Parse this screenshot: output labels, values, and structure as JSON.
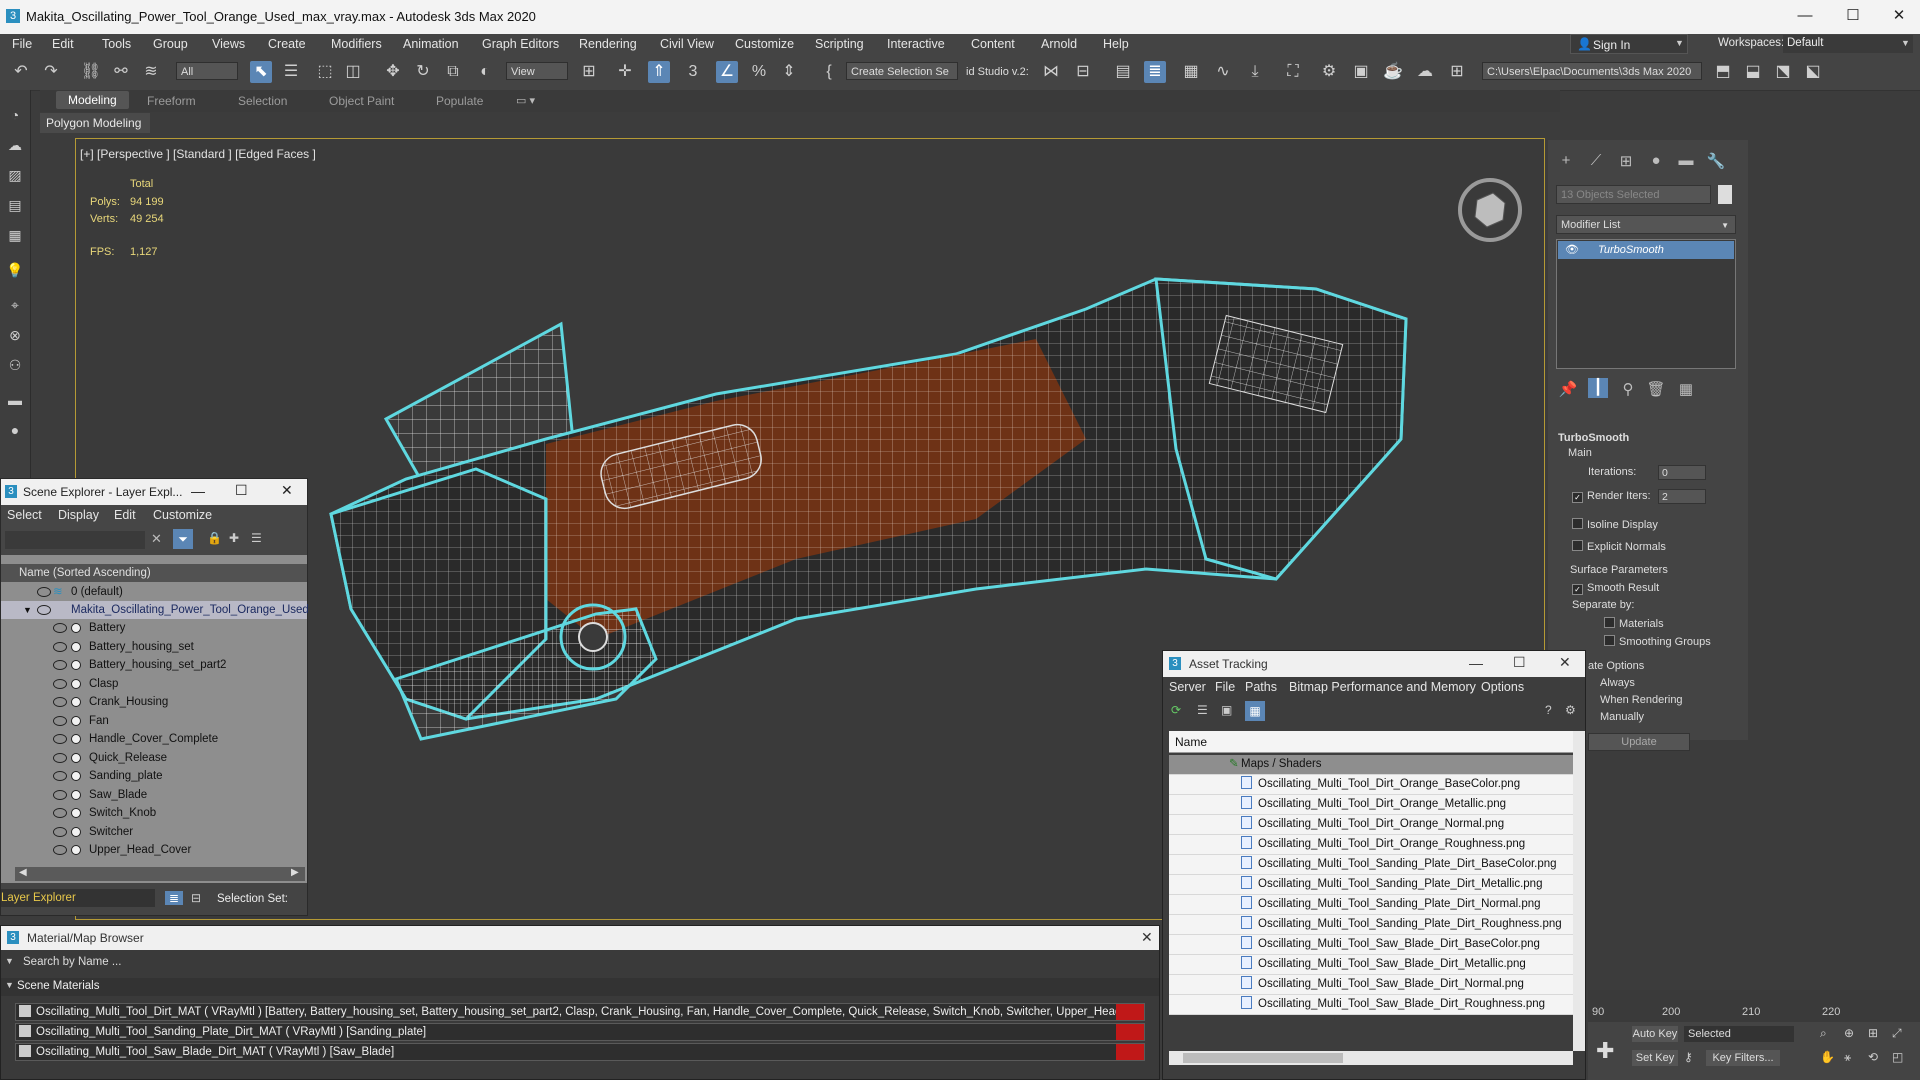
{
  "window": {
    "title": "Makita_Oscillating_Power_Tool_Orange_Used_max_vray.max - Autodesk 3ds Max 2020",
    "minimize": "—",
    "maximize": "☐",
    "close": "✕"
  },
  "menu": [
    "File",
    "Edit",
    "Tools",
    "Group",
    "Views",
    "Create",
    "Modifiers",
    "Animation",
    "Graph Editors",
    "Rendering",
    "Civil View",
    "Customize",
    "Scripting",
    "Interactive",
    "Content",
    "Arnold",
    "Help"
  ],
  "account": {
    "sign_in": "Sign In",
    "workspaces_label": "Workspaces:",
    "workspace": "Default"
  },
  "toolbar": {
    "selection_filter": "All",
    "ref_coord": "View",
    "create_selection_set": "Create Selection Se",
    "studio": "id Studio v.2:",
    "project_path": "C:\\Users\\Elpac\\Documents\\3ds Max 2020"
  },
  "ribbon": {
    "tabs": [
      "Modeling",
      "Freeform",
      "Selection",
      "Object Paint",
      "Populate"
    ],
    "panel": "Polygon Modeling"
  },
  "viewport": {
    "label": "[+] [Perspective ] [Standard ] [Edged Faces ]",
    "stats_header": "Total",
    "polys_label": "Polys:",
    "polys": "94 199",
    "verts_label": "Verts:",
    "verts": "49 254",
    "fps_label": "FPS:",
    "fps": "1,127"
  },
  "command_panel": {
    "objects_selected": "13 Objects Selected",
    "modifier_list": "Modifier List",
    "modifier": "TurboSmooth",
    "rollout_title": "TurboSmooth",
    "main": "Main",
    "iterations_label": "Iterations:",
    "iterations": "0",
    "render_iters_label": "Render Iters:",
    "render_iters": "2",
    "isoline": "Isoline Display",
    "explicit_normals": "Explicit Normals",
    "surface_params": "Surface Parameters",
    "smooth_result": "Smooth Result",
    "separate_by": "Separate by:",
    "materials": "Materials",
    "smoothing_groups": "Smoothing Groups",
    "update_options": "ate Options",
    "always": "Always",
    "when_rendering": "When Rendering",
    "manually": "Manually",
    "update": "Update"
  },
  "scene_explorer": {
    "title": "Scene Explorer - Layer Expl...",
    "menu": [
      "Select",
      "Display",
      "Edit",
      "Customize"
    ],
    "column": "Name (Sorted Ascending)",
    "default_layer": "0 (default)",
    "root": "Makita_Oscillating_Power_Tool_Orange_Used",
    "items": [
      "Battery",
      "Battery_housing_set",
      "Battery_housing_set_part2",
      "Clasp",
      "Crank_Housing",
      "Fan",
      "Handle_Cover_Complete",
      "Quick_Release",
      "Sanding_plate",
      "Saw_Blade",
      "Switch_Knob",
      "Switcher",
      "Upper_Head_Cover"
    ],
    "footer_layer": "Layer Explorer",
    "footer_selset": "Selection Set:"
  },
  "material_browser": {
    "title": "Material/Map Browser",
    "search": "Search by Name ...",
    "group": "Scene Materials",
    "rows": [
      "Oscillating_Multi_Tool_Dirt_MAT ( VRayMtl ) [Battery, Battery_housing_set, Battery_housing_set_part2, Clasp, Crank_Housing, Fan, Handle_Cover_Complete, Quick_Release, Switch_Knob, Switcher, Upper_Head_Cover]",
      "Oscillating_Multi_Tool_Sanding_Plate_Dirt_MAT ( VRayMtl ) [Sanding_plate]",
      "Oscillating_Multi_Tool_Saw_Blade_Dirt_MAT ( VRayMtl ) [Saw_Blade]"
    ]
  },
  "asset_tracking": {
    "title": "Asset Tracking",
    "menu": [
      "Server",
      "File",
      "Paths",
      "Bitmap Performance and Memory",
      "Options"
    ],
    "column": "Name",
    "group": "Maps / Shaders",
    "files": [
      "Oscillating_Multi_Tool_Dirt_Orange_BaseColor.png",
      "Oscillating_Multi_Tool_Dirt_Orange_Metallic.png",
      "Oscillating_Multi_Tool_Dirt_Orange_Normal.png",
      "Oscillating_Multi_Tool_Dirt_Orange_Roughness.png",
      "Oscillating_Multi_Tool_Sanding_Plate_Dirt_BaseColor.png",
      "Oscillating_Multi_Tool_Sanding_Plate_Dirt_Metallic.png",
      "Oscillating_Multi_Tool_Sanding_Plate_Dirt_Normal.png",
      "Oscillating_Multi_Tool_Sanding_Plate_Dirt_Roughness.png",
      "Oscillating_Multi_Tool_Saw_Blade_Dirt_BaseColor.png",
      "Oscillating_Multi_Tool_Saw_Blade_Dirt_Metallic.png",
      "Oscillating_Multi_Tool_Saw_Blade_Dirt_Normal.png",
      "Oscillating_Multi_Tool_Saw_Blade_Dirt_Roughness.png"
    ]
  },
  "timeline": {
    "ticks": [
      "90",
      "200",
      "210",
      "220"
    ],
    "auto_key": "Auto Key",
    "set_key": "Set Key",
    "key_mode": "Selected",
    "key_filters": "Key Filters..."
  },
  "colors": {
    "accent": "#5b86b5",
    "wire": "#5fd8e0",
    "orange": "#8a3a12",
    "viewport_border": "#b59a35"
  }
}
